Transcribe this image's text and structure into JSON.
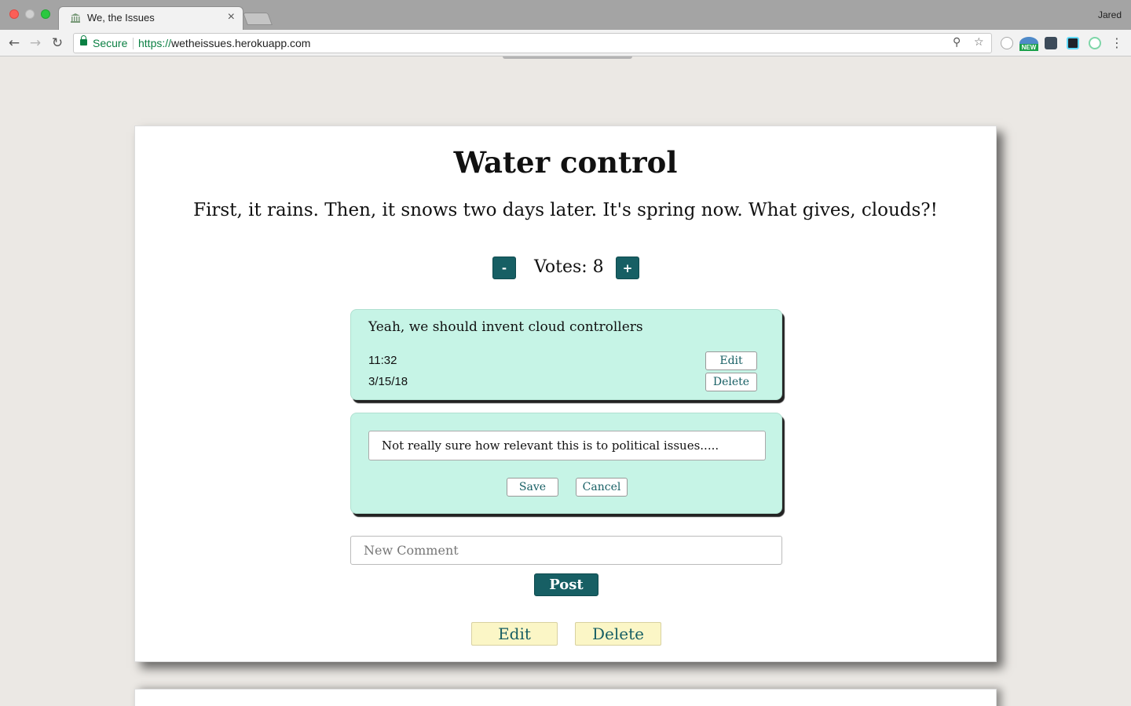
{
  "browser": {
    "tab_title": "We, the Issues",
    "tab_close": "×",
    "profile": "Jared",
    "secure_label": "Secure",
    "url_scheme": "https://",
    "url_host": "wetheissues.herokuapp.com",
    "icons": [
      "back-icon",
      "forward-icon",
      "reload-icon",
      "lock-icon",
      "zoom-icon",
      "star-icon",
      "menu-icon"
    ],
    "extension_badge": "NEW"
  },
  "issue": {
    "title": "Water control",
    "body": "First, it rains. Then, it snows two days later. It's spring now. What gives, clouds?!",
    "votes_label": "Votes: 8",
    "downvote_label": "-",
    "upvote_label": "+",
    "edit_label": "Edit",
    "delete_label": "Delete"
  },
  "comments": [
    {
      "text": "Yeah, we should invent cloud controllers",
      "time": "11:32",
      "date": "3/15/18",
      "edit_label": "Edit",
      "delete_label": "Delete"
    }
  ],
  "editing_comment": {
    "value": "Not really sure how relevant this is to political issues.....",
    "save_label": "Save",
    "cancel_label": "Cancel"
  },
  "new_comment": {
    "placeholder": "New Comment",
    "post_label": "Post"
  },
  "colors": {
    "accent": "#175f64",
    "comment_bg": "#c6f4e6",
    "issue_button_bg": "#fbf6c6",
    "page_bg": "#ebe8e4"
  }
}
